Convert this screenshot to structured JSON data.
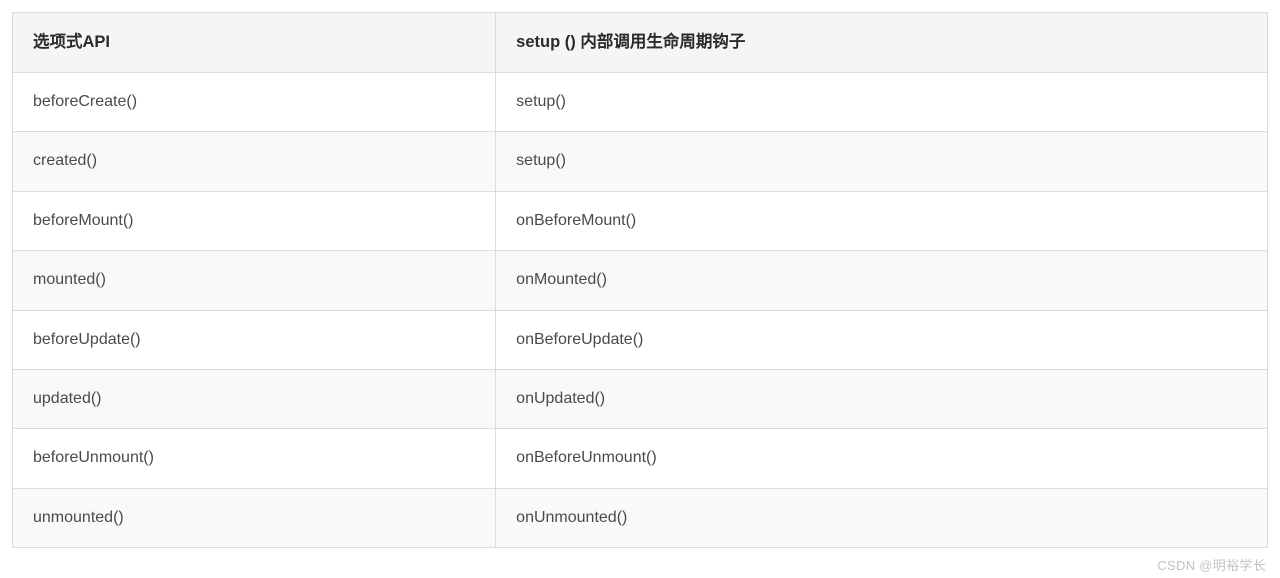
{
  "table": {
    "headers": [
      "选项式API",
      "setup () 内部调用生命周期钩子"
    ],
    "rows": [
      [
        "beforeCreate()",
        "setup()"
      ],
      [
        "created()",
        "setup()"
      ],
      [
        "beforeMount()",
        "onBeforeMount()"
      ],
      [
        "mounted()",
        "onMounted()"
      ],
      [
        "beforeUpdate()",
        "onBeforeUpdate()"
      ],
      [
        "updated()",
        "onUpdated()"
      ],
      [
        "beforeUnmount()",
        "onBeforeUnmount()"
      ],
      [
        "unmounted()",
        "onUnmounted()"
      ]
    ]
  },
  "watermark": "CSDN @明裕学长"
}
